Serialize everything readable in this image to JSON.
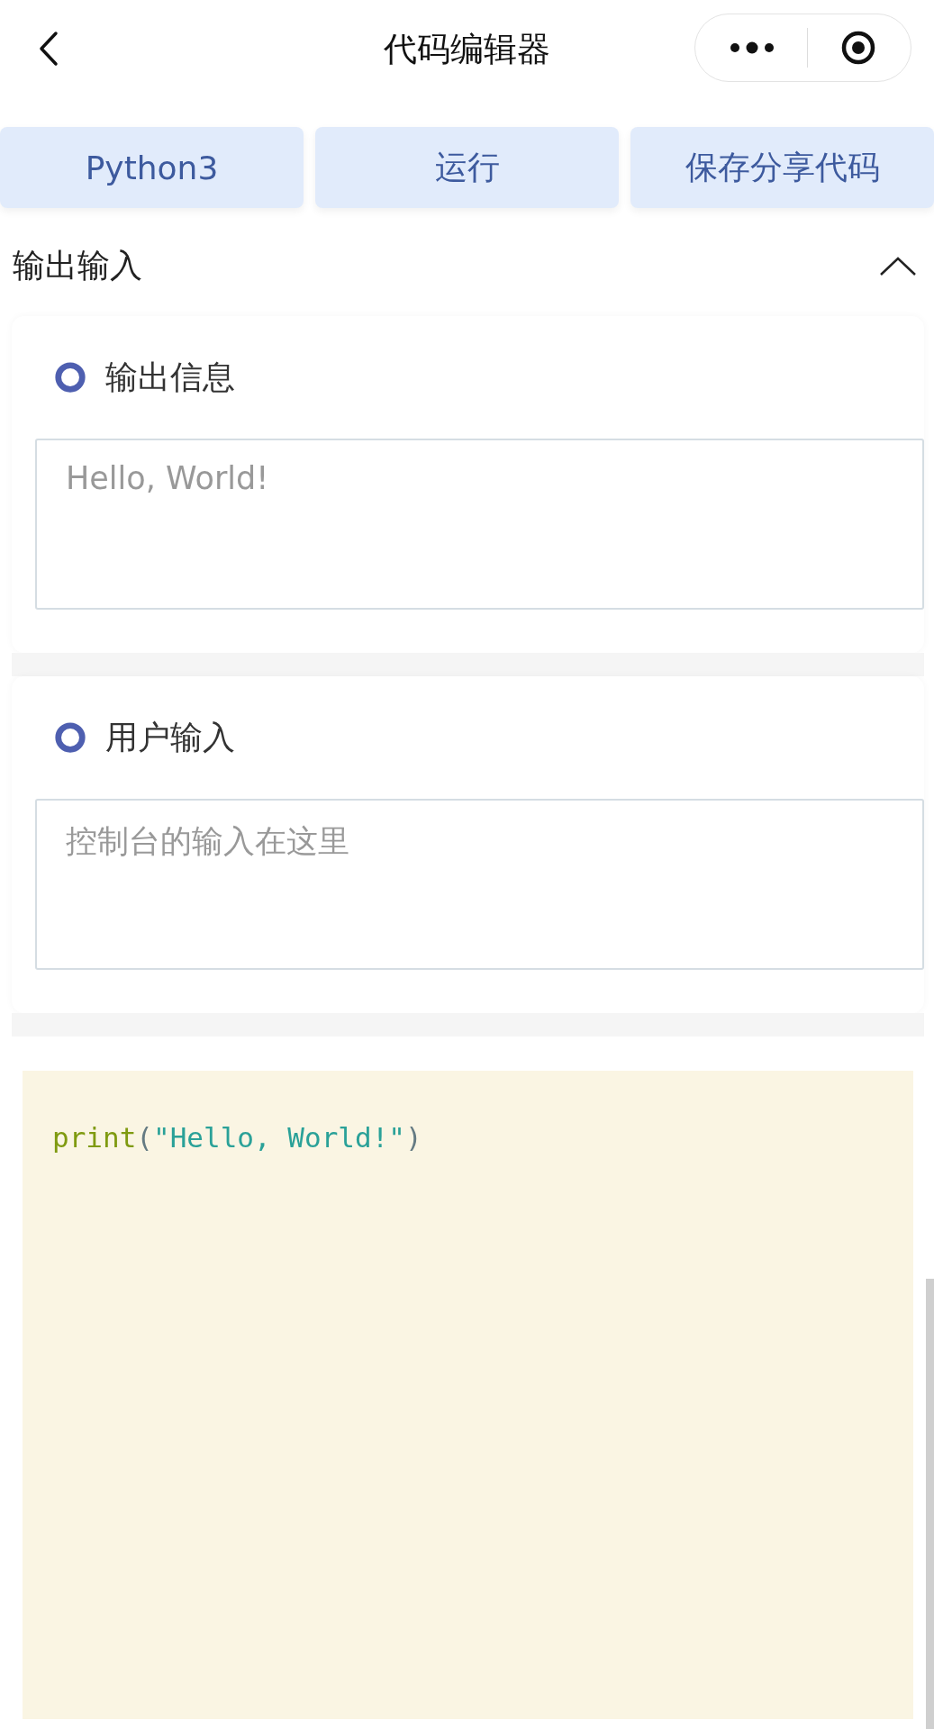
{
  "nav": {
    "title": "代码编辑器"
  },
  "toolbar": [
    {
      "label": "Python3"
    },
    {
      "label": "运行"
    },
    {
      "label": "保存分享代码"
    }
  ],
  "section": {
    "title": "输出输入",
    "expanded": true
  },
  "panels": [
    {
      "label": "输出信息",
      "value": "Hello, World!"
    },
    {
      "label": "用户输入",
      "placeholder": "控制台的输入在这里"
    }
  ],
  "code": [
    {
      "kind": "function",
      "text": "print"
    },
    {
      "kind": "punct",
      "text": "("
    },
    {
      "kind": "string",
      "text": "\"Hello, World!\""
    },
    {
      "kind": "punct",
      "text": ")"
    }
  ]
}
